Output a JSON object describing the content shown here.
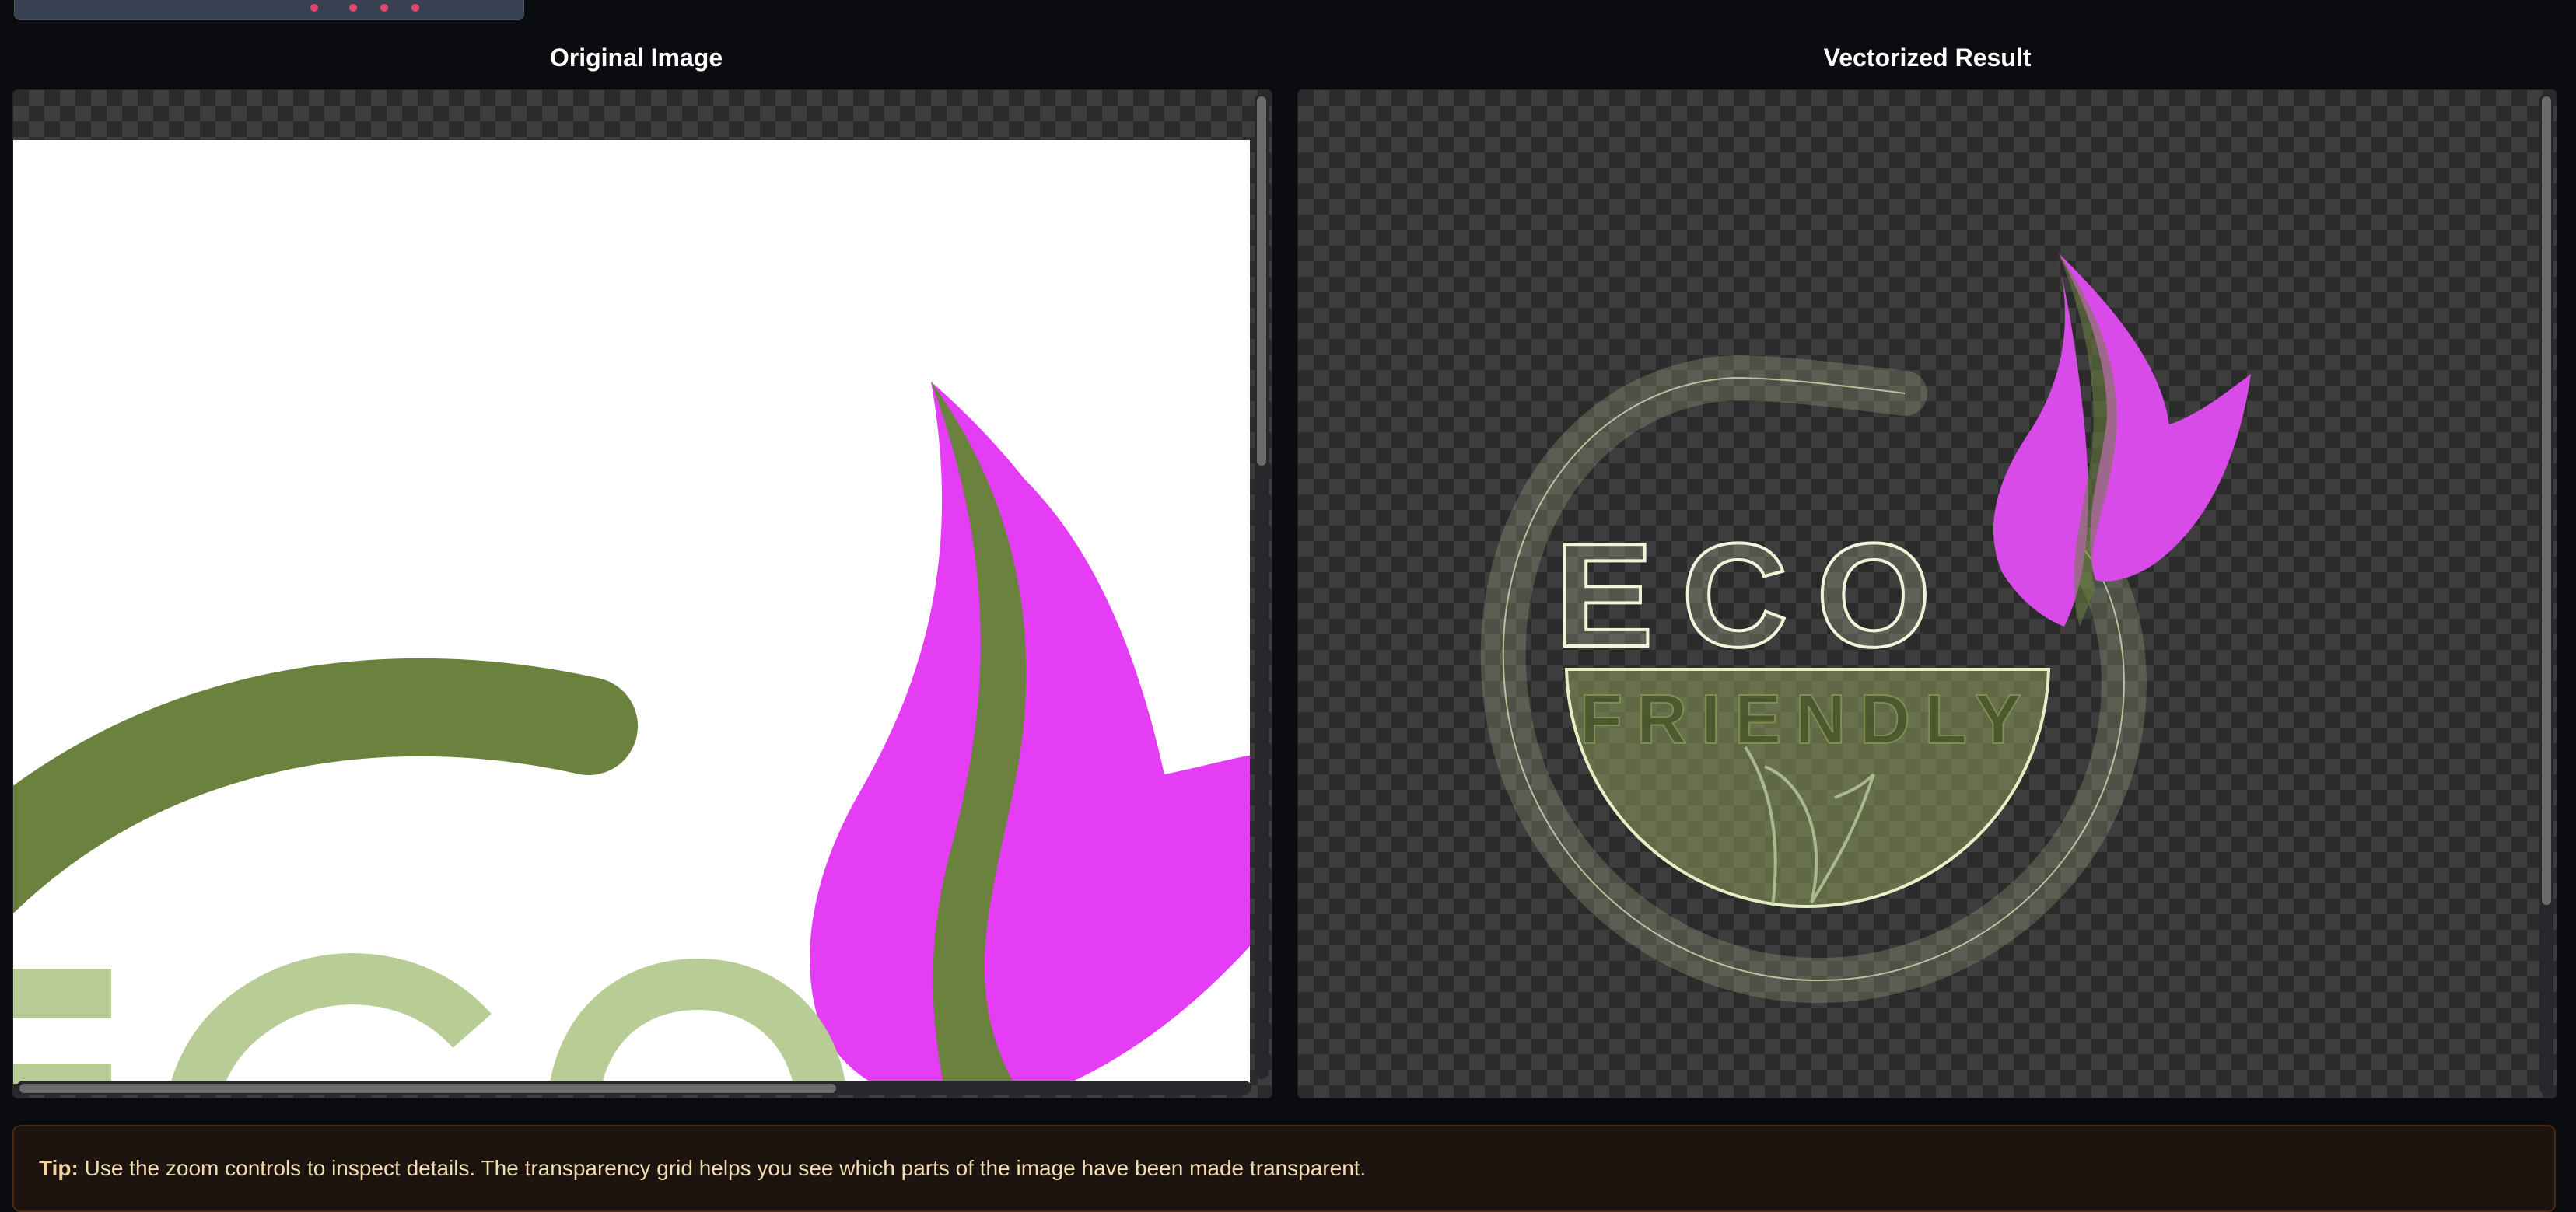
{
  "panels": {
    "original_title": "Original Image",
    "vectorized_title": "Vectorized Result"
  },
  "logo": {
    "word_top": "ECO",
    "word_bottom": "FRIENDLY"
  },
  "tip": {
    "label": "Tip:",
    "text": "Use the zoom controls to inspect details. The transparency grid helps you see which parts of the image have been made transparent."
  },
  "colors": {
    "background": "#0b0c0f",
    "leaf_magenta": "#e53cf5",
    "leaf_green": "#6b823e",
    "text_light_green": "#b8cc96",
    "tip_background": "#1d1410"
  }
}
